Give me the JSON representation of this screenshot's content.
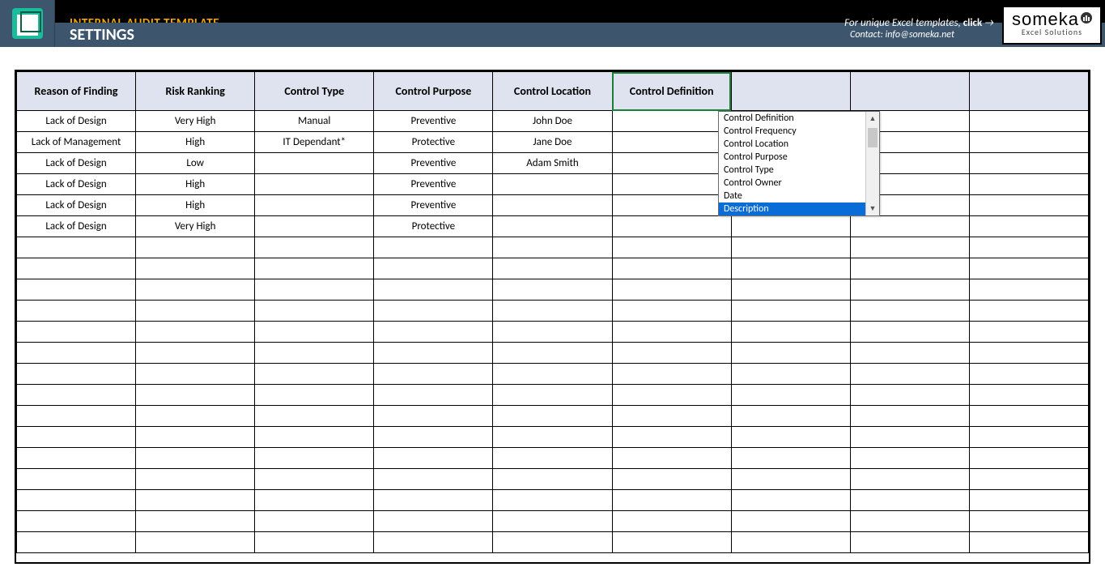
{
  "banner": {
    "title1": "INTERNAL AUDIT TEMPLATE",
    "title2": "SETTINGS",
    "cta_prefix": "For unique Excel templates, ",
    "cta_bold": "click",
    "contact": "Contact: info@someka.net",
    "logo_main": "someka",
    "logo_sub": "Excel Solutions"
  },
  "columns": [
    "Reason of Finding",
    "Risk Ranking",
    "Control Type",
    "Control Purpose",
    "Control Location",
    "Control Definition",
    "",
    "",
    ""
  ],
  "selected_col_index": 5,
  "rows": [
    [
      "Lack of Design",
      "Very High",
      "Manual",
      "Preventive",
      "John Doe",
      "",
      "",
      "",
      ""
    ],
    [
      "Lack of Management",
      "High",
      "IT Dependant*",
      "Protective",
      "Jane Doe",
      "",
      "",
      "",
      ""
    ],
    [
      "Lack of Design",
      "Low",
      "",
      "Preventive",
      "Adam Smith",
      "",
      "",
      "",
      ""
    ],
    [
      "Lack of Design",
      "High",
      "",
      "Preventive",
      "",
      "",
      "",
      "",
      ""
    ],
    [
      "Lack of Design",
      "High",
      "",
      "Preventive",
      "",
      "",
      "",
      "",
      ""
    ],
    [
      "Lack of Design",
      "Very High",
      "",
      "Protective",
      "",
      "",
      "",
      "",
      ""
    ],
    [
      "",
      "",
      "",
      "",
      "",
      "",
      "",
      "",
      ""
    ],
    [
      "",
      "",
      "",
      "",
      "",
      "",
      "",
      "",
      ""
    ],
    [
      "",
      "",
      "",
      "",
      "",
      "",
      "",
      "",
      ""
    ],
    [
      "",
      "",
      "",
      "",
      "",
      "",
      "",
      "",
      ""
    ],
    [
      "",
      "",
      "",
      "",
      "",
      "",
      "",
      "",
      ""
    ],
    [
      "",
      "",
      "",
      "",
      "",
      "",
      "",
      "",
      ""
    ],
    [
      "",
      "",
      "",
      "",
      "",
      "",
      "",
      "",
      ""
    ],
    [
      "",
      "",
      "",
      "",
      "",
      "",
      "",
      "",
      ""
    ],
    [
      "",
      "",
      "",
      "",
      "",
      "",
      "",
      "",
      ""
    ],
    [
      "",
      "",
      "",
      "",
      "",
      "",
      "",
      "",
      ""
    ],
    [
      "",
      "",
      "",
      "",
      "",
      "",
      "",
      "",
      ""
    ],
    [
      "",
      "",
      "",
      "",
      "",
      "",
      "",
      "",
      ""
    ],
    [
      "",
      "",
      "",
      "",
      "",
      "",
      "",
      "",
      ""
    ],
    [
      "",
      "",
      "",
      "",
      "",
      "",
      "",
      "",
      ""
    ],
    [
      "",
      "",
      "",
      "",
      "",
      "",
      "",
      "",
      ""
    ]
  ],
  "dropdown": {
    "options": [
      "Control Definition",
      "Control Frequency",
      "Control Location",
      "Control Purpose",
      "Control Type",
      "Control Owner",
      "Date",
      "Description"
    ],
    "selected_index": 7
  }
}
